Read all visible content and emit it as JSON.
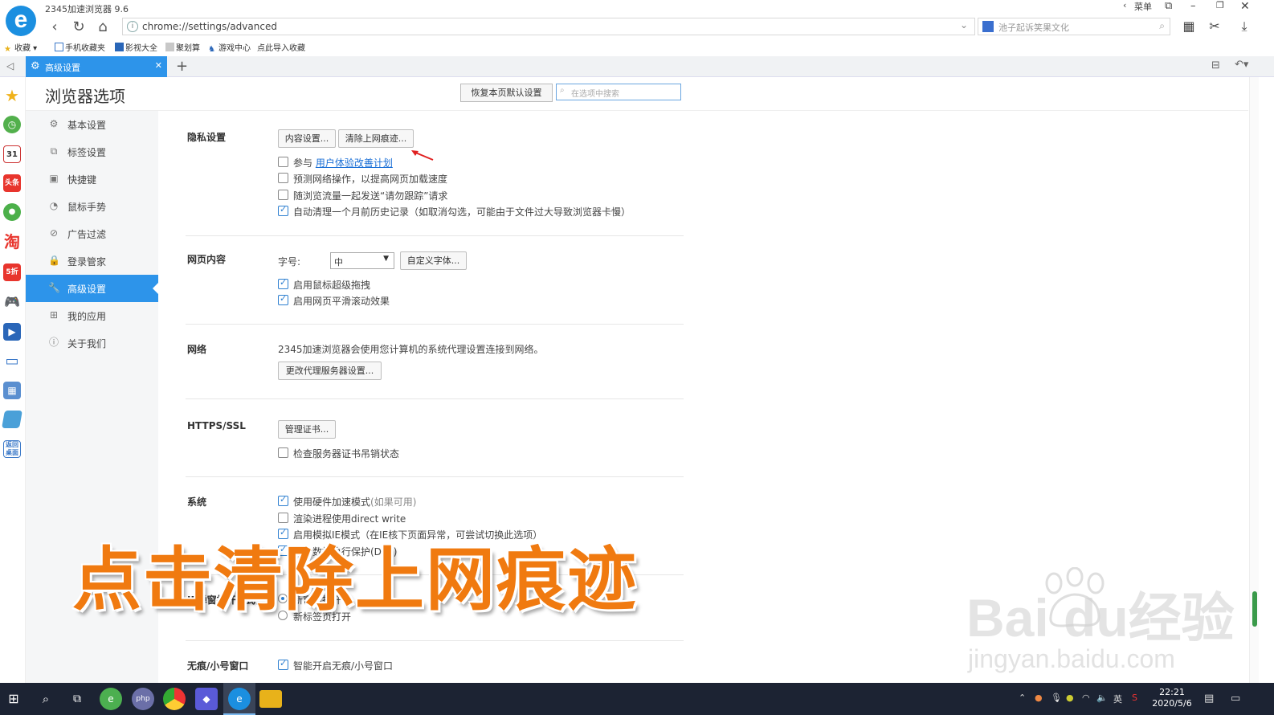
{
  "window": {
    "title": "2345加速浏览器 9.6",
    "menu_label": "菜单"
  },
  "address_bar": {
    "url": "chrome://settings/advanced"
  },
  "search_bar": {
    "placeholder": "池子起诉笑果文化"
  },
  "bookmarks": [
    {
      "label": "收藏",
      "icon": "star-icon"
    },
    {
      "label": "手机收藏夹",
      "icon": "phone-icon"
    },
    {
      "label": "影视大全",
      "icon": "video-icon"
    },
    {
      "label": "聚划算",
      "icon": "deal-icon"
    },
    {
      "label": "游戏中心",
      "icon": "game-icon"
    },
    {
      "label": "点此导入收藏",
      "icon": ""
    }
  ],
  "tab": {
    "label": "高级设置"
  },
  "quickbar": {
    "calendar_day": "31",
    "toutiao": "头条",
    "taobao": "淘",
    "fivesix": "5折",
    "game": "游",
    "more": "返回桌面"
  },
  "settings": {
    "page_title": "浏览器选项",
    "reset_button": "恢复本页默认设置",
    "search_placeholder": "在选项中搜索",
    "nav": [
      {
        "label": "基本设置",
        "icon": "gear-icon"
      },
      {
        "label": "标签设置",
        "icon": "tab-icon"
      },
      {
        "label": "快捷键",
        "icon": "keyboard-icon"
      },
      {
        "label": "鼠标手势",
        "icon": "mouse-icon"
      },
      {
        "label": "广告过滤",
        "icon": "block-icon"
      },
      {
        "label": "登录管家",
        "icon": "lock-icon"
      },
      {
        "label": "高级设置",
        "icon": "wrench-icon",
        "active": true
      },
      {
        "label": "我的应用",
        "icon": "apps-icon"
      },
      {
        "label": "关于我们",
        "icon": "info-icon"
      }
    ],
    "privacy": {
      "title": "隐私设置",
      "content_btn": "内容设置...",
      "clear_btn": "清除上网痕迹...",
      "opt1_prefix": "参与",
      "opt1_link": "用户体验改善计划",
      "opt2": "预测网络操作，以提高网页加载速度",
      "opt3": "随浏览流量一起发送“请勿跟踪”请求",
      "opt4": "自动清理一个月前历史记录（如取消勾选，可能由于文件过大导致浏览器卡慢）"
    },
    "web_content": {
      "title": "网页内容",
      "font_size_label": "字号:",
      "font_size_value": "中",
      "custom_font_btn": "自定义字体...",
      "opt1": "启用鼠标超级拖拽",
      "opt2": "启用网页平滑滚动效果"
    },
    "network": {
      "title": "网络",
      "desc": "2345加速浏览器会使用您计算机的系统代理设置连接到网络。",
      "proxy_btn": "更改代理服务器设置..."
    },
    "https": {
      "title": "HTTPS/SSL",
      "cert_btn": "管理证书...",
      "opt1": "检查服务器证书吊销状态"
    },
    "system": {
      "title": "系统",
      "opt1": "使用硬件加速模式",
      "opt1_note": "(如果可用)",
      "opt2": "渲染进程使用direct write",
      "opt3": "启用模拟IE模式（在IE核下页面异常，可尝试切换此选项）",
      "opt4": "启用数据执行保护(DEP)"
    },
    "ie_popup": {
      "title": "IE弹窗打开方式",
      "opt1": "新窗口打开",
      "opt2": "新标签页打开"
    },
    "incognito": {
      "title": "无痕/小号窗口",
      "opt1": "智能开启无痕/小号窗口"
    }
  },
  "overlay": {
    "caption": "点击清除上网痕迹",
    "watermark_brand": "Bai  du经验",
    "watermark_url": "jingyan.baidu.com"
  },
  "taskbar": {
    "time": "22:21",
    "date": "2020/5/6",
    "ime": "英",
    "php_label": "php"
  },
  "colors": {
    "accent": "#2d94ea",
    "caption": "#f07a10",
    "taskbar": "#1c2333"
  }
}
